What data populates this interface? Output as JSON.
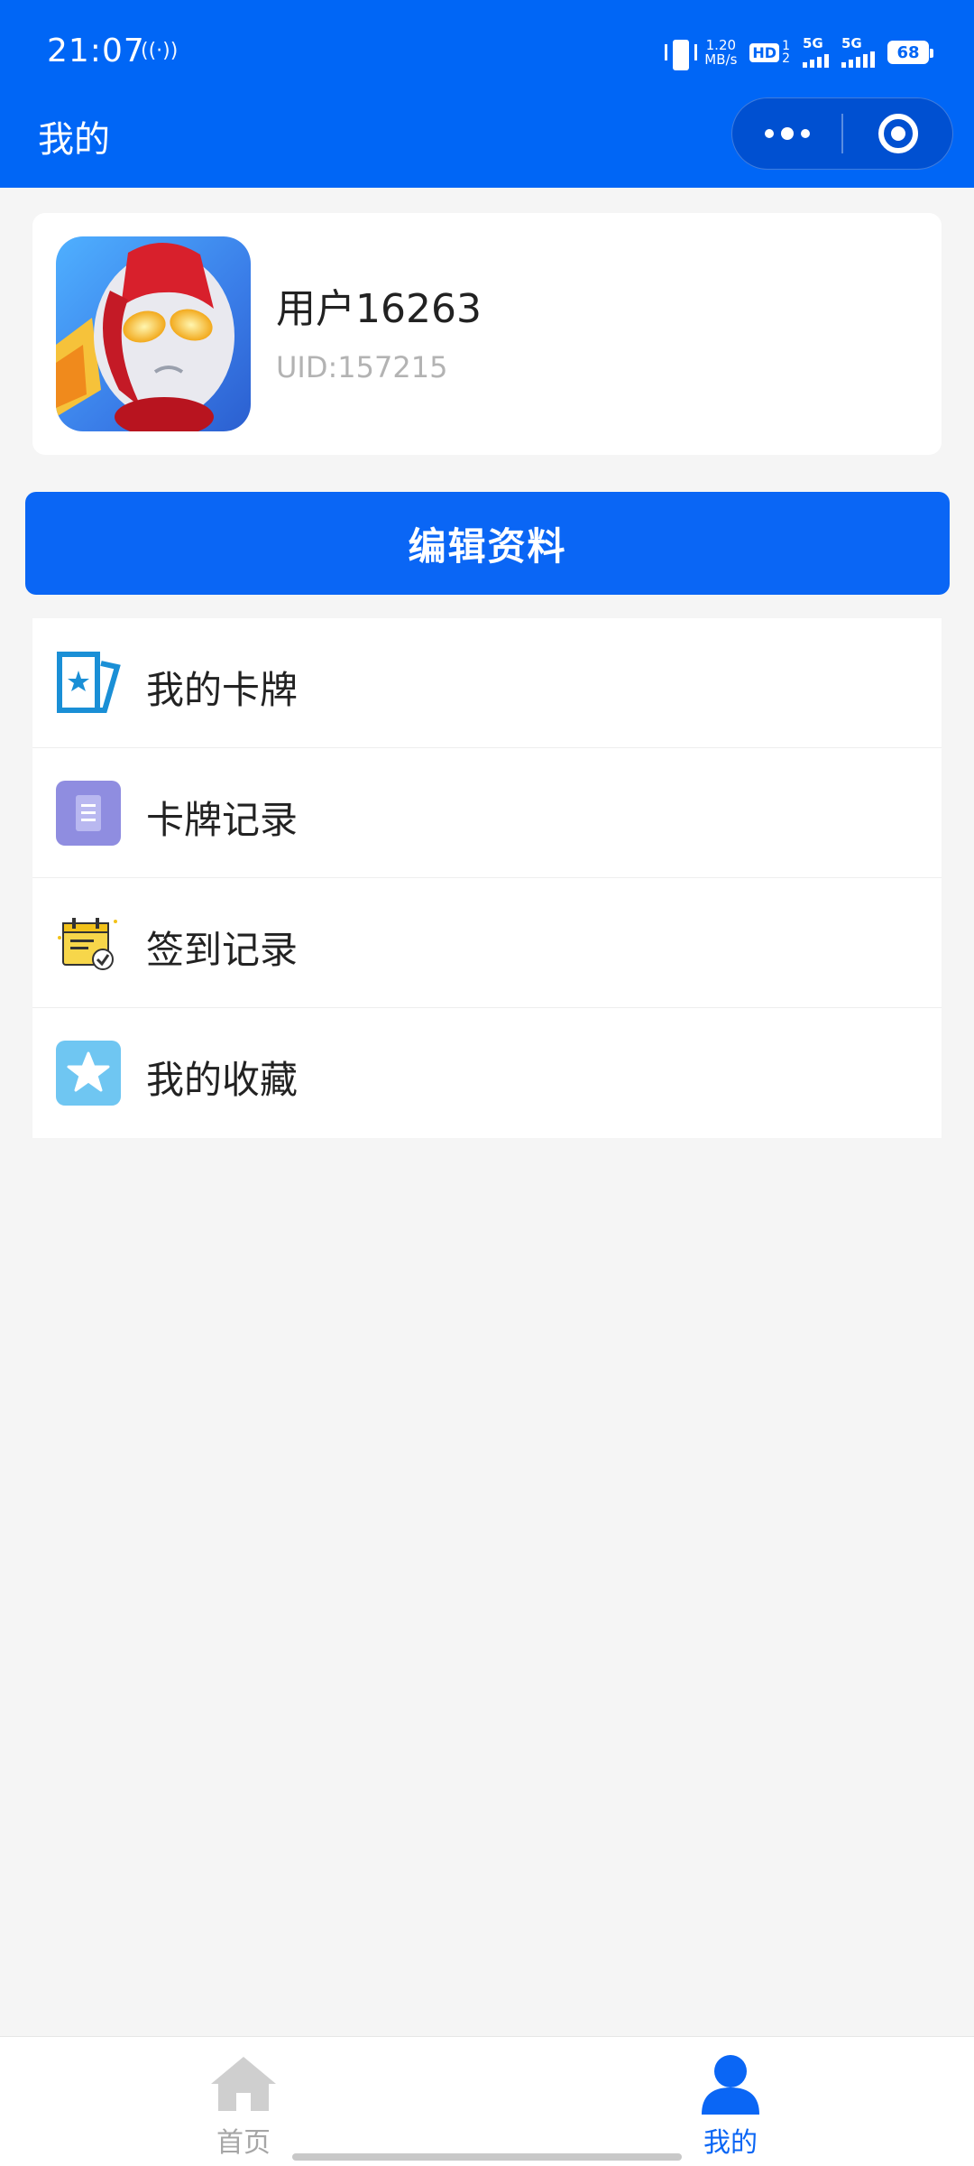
{
  "status_bar": {
    "time": "21:07",
    "nfc": "((·))",
    "net_speed_value": "1.20",
    "net_speed_unit": "MB/s",
    "hd_label": "HD",
    "hd_sub_top": "1",
    "hd_sub_bottom": "2",
    "sim1_label": "5G",
    "sim2_label": "5G",
    "battery": "68"
  },
  "header": {
    "title": "我的",
    "background": "#0066f6"
  },
  "profile": {
    "username": "用户16263",
    "uid": "UID:157215"
  },
  "edit_button": {
    "label": "编辑资料",
    "color": "#0a66f5"
  },
  "menu": {
    "items": [
      {
        "label": "我的卡牌",
        "icon": "card-icon"
      },
      {
        "label": "卡牌记录",
        "icon": "document-icon"
      },
      {
        "label": "签到记录",
        "icon": "calendar-check-icon"
      },
      {
        "label": "我的收藏",
        "icon": "star-icon"
      }
    ]
  },
  "bottom_nav": {
    "tabs": [
      {
        "label": "首页",
        "icon": "home-icon",
        "active": false
      },
      {
        "label": "我的",
        "icon": "user-icon",
        "active": true
      }
    ],
    "active_color": "#0a66f5",
    "inactive_color": "#a6a6a6"
  }
}
